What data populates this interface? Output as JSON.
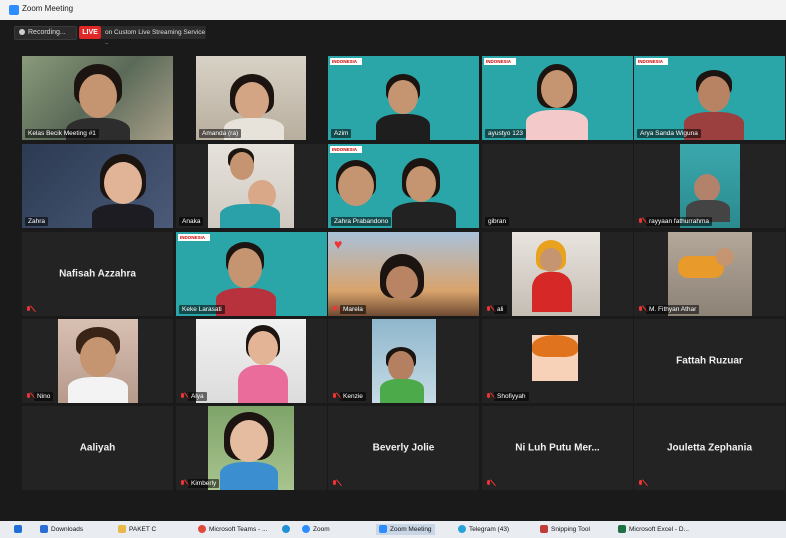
{
  "window": {
    "title": "Zoom Meeting"
  },
  "toolbar": {
    "recording_label": "Recording...",
    "live_label": "LIVE",
    "stream_label": "on Custom Live Streaming Service ▾"
  },
  "participants": [
    {
      "name": "Kelas Becik Meeting #1",
      "muted": false
    },
    {
      "name": "Amanda (ra)",
      "muted": false
    },
    {
      "name": "Azim",
      "muted": false
    },
    {
      "name": "ayustyo 123",
      "muted": false
    },
    {
      "name": "Arya Sanda Wiguna",
      "muted": false
    },
    {
      "name": "Zahra",
      "muted": false
    },
    {
      "name": "Anaka",
      "muted": false
    },
    {
      "name": "Zahra Prabandono",
      "muted": false
    },
    {
      "name": "gibran",
      "muted": false
    },
    {
      "name": "rayyaan fathurrahma",
      "muted": true
    },
    {
      "name": "Nafisah Azzahra",
      "muted": true
    },
    {
      "name": "Keke Larasati",
      "muted": false
    },
    {
      "name": "Marela",
      "muted": true
    },
    {
      "name": "ali",
      "muted": true
    },
    {
      "name": "M. Fithyan Athar",
      "muted": true
    },
    {
      "name": "Nino",
      "muted": true
    },
    {
      "name": "Alya",
      "muted": true
    },
    {
      "name": "Kenzie",
      "muted": true
    },
    {
      "name": "Shofiyyah",
      "muted": true
    },
    {
      "name": "Fattah Ruzuar",
      "muted": false
    },
    {
      "name": "Aaliyah",
      "muted": false
    },
    {
      "name": "Kimberly",
      "muted": true
    },
    {
      "name": "Beverly Jolie",
      "muted": true
    },
    {
      "name": "Ni Luh Putu Mer...",
      "muted": true
    },
    {
      "name": "Jouletta Zephania",
      "muted": true
    }
  ],
  "branding": {
    "badge_label": "INDONESIA"
  },
  "taskbar": {
    "items": [
      {
        "label": "Downloads",
        "icon": "folder-download-icon",
        "color": "#2b6fd6"
      },
      {
        "label": "PAKET C",
        "icon": "folder-icon",
        "color": "#e8b84a"
      },
      {
        "label": "Microsoft Teams - ...",
        "icon": "chrome-icon",
        "color": "#e04a3a"
      },
      {
        "label": "",
        "icon": "edge-icon",
        "color": "#1f8fd6"
      },
      {
        "label": "Zoom",
        "icon": "zoom-icon",
        "color": "#2d8cff"
      },
      {
        "label": "Zoom Meeting",
        "icon": "zoom-icon",
        "color": "#2d8cff"
      },
      {
        "label": "Telegram (43)",
        "icon": "telegram-icon",
        "color": "#2aa1da"
      },
      {
        "label": "Snipping Tool",
        "icon": "snipping-icon",
        "color": "#c23b3b"
      },
      {
        "label": "Microsoft Excel - D...",
        "icon": "excel-icon",
        "color": "#1e7145"
      }
    ]
  }
}
